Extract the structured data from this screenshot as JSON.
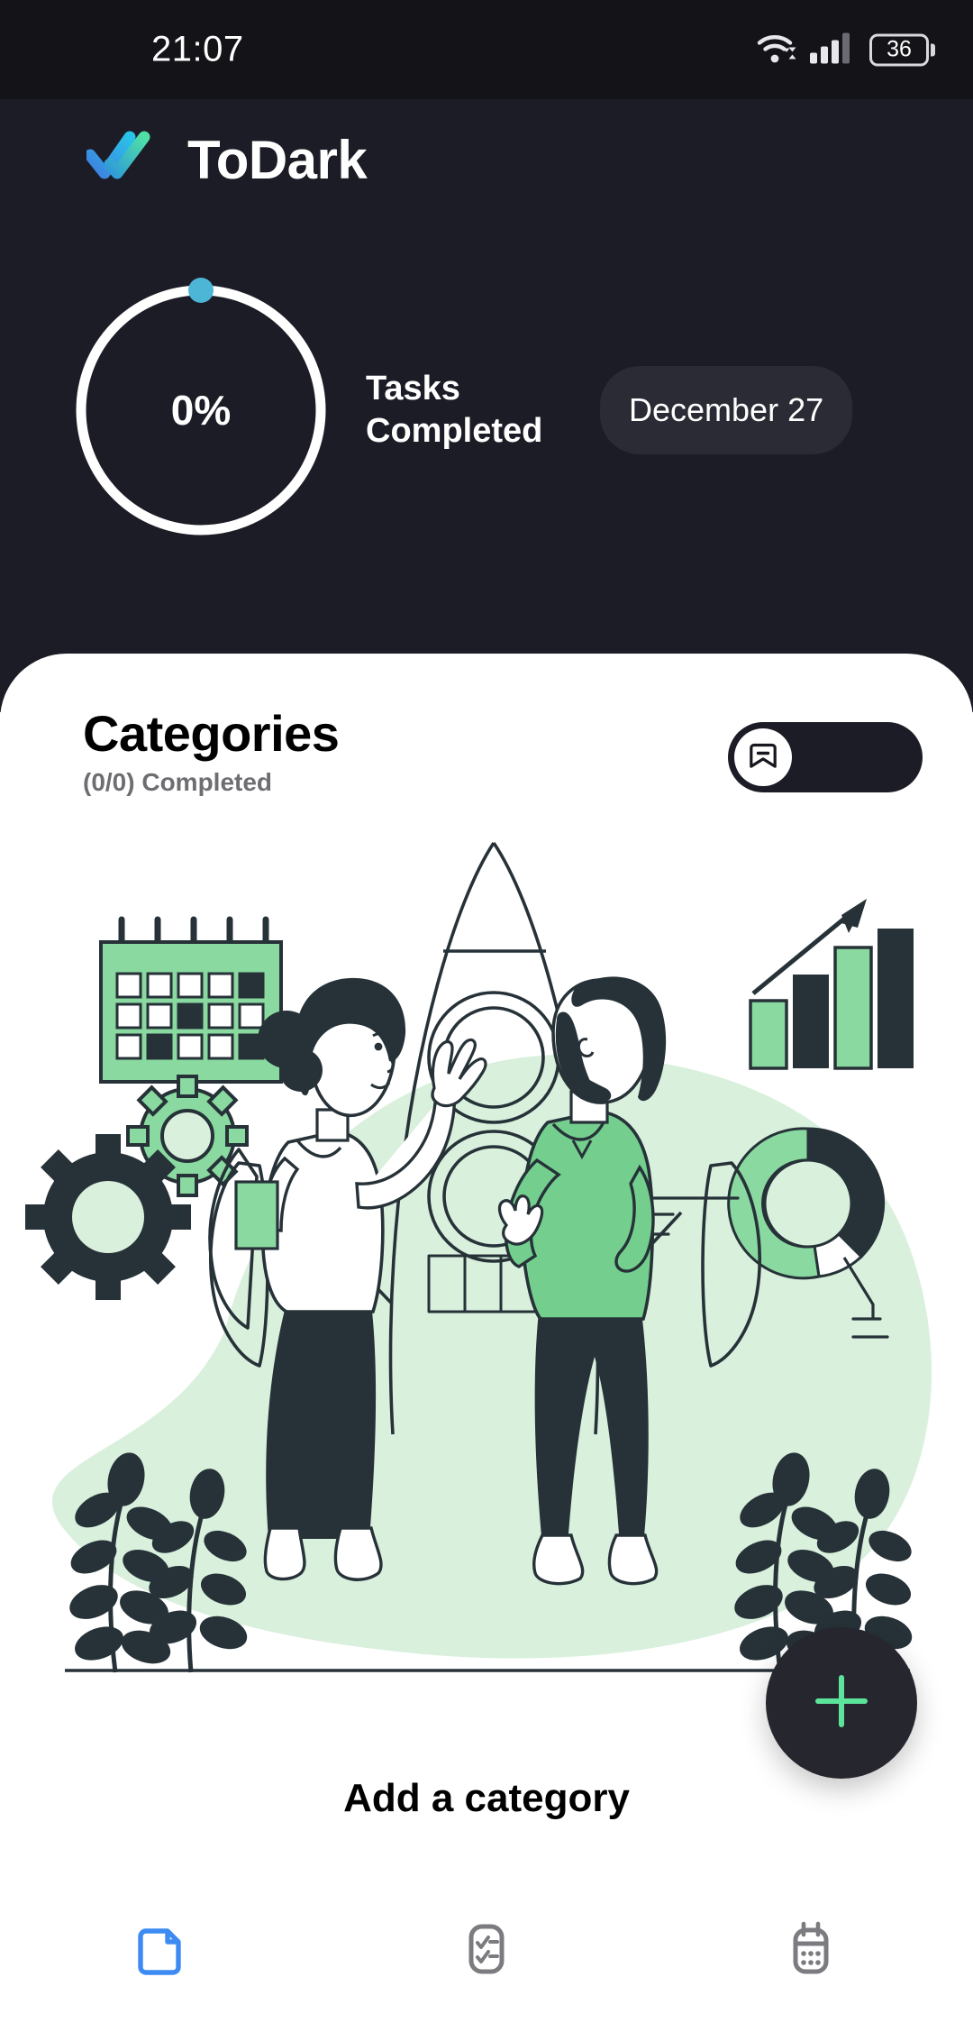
{
  "status_bar": {
    "time": "21:07",
    "wifi_icon": "wifi-icon",
    "signal_icon": "cellular-signal-icon",
    "battery_level": "36"
  },
  "header": {
    "logo_icon": "double-check-logo-icon",
    "app_title": "ToDark",
    "progress": {
      "percent_label": "0%",
      "percent_value": 0,
      "track_color": "#ffffff",
      "indicator_color": "#4db6d6"
    },
    "tasks_label_line1": "Tasks",
    "tasks_label_line2": "Completed",
    "date_pill_label": "December 27",
    "background_color": "#1c1c26"
  },
  "categories": {
    "title": "Categories",
    "subtitle": "(0/0) Completed",
    "toggle": {
      "icon": "bookmark-minus-icon",
      "state": "off"
    }
  },
  "illustration": {
    "name": "team-launching-rocket-illustration",
    "blob_color": "#d9f0dd",
    "green_accent": "#8ad9a0",
    "dark_accent": "#263238",
    "elements": [
      "calendar-icon",
      "gear-large-icon",
      "gear-small-icon",
      "rocket-illustration",
      "woman-character",
      "man-character",
      "bar-chart-icon",
      "donut-chart-icon",
      "plant-left-icon",
      "plant-right-icon"
    ]
  },
  "empty_state": {
    "add_category_label": "Add a category"
  },
  "fab": {
    "icon": "plus-icon",
    "background_color": "#26262e",
    "icon_color": "#5ce49a"
  },
  "bottom_nav": {
    "items": [
      {
        "icon": "folder-icon",
        "label": "Categories",
        "active": true,
        "color": "#3d8bf2"
      },
      {
        "icon": "checklist-icon",
        "label": "Tasks",
        "active": false,
        "color": "#7b7b80"
      },
      {
        "icon": "calendar-icon",
        "label": "Calendar",
        "active": false,
        "color": "#7b7b80"
      }
    ]
  }
}
